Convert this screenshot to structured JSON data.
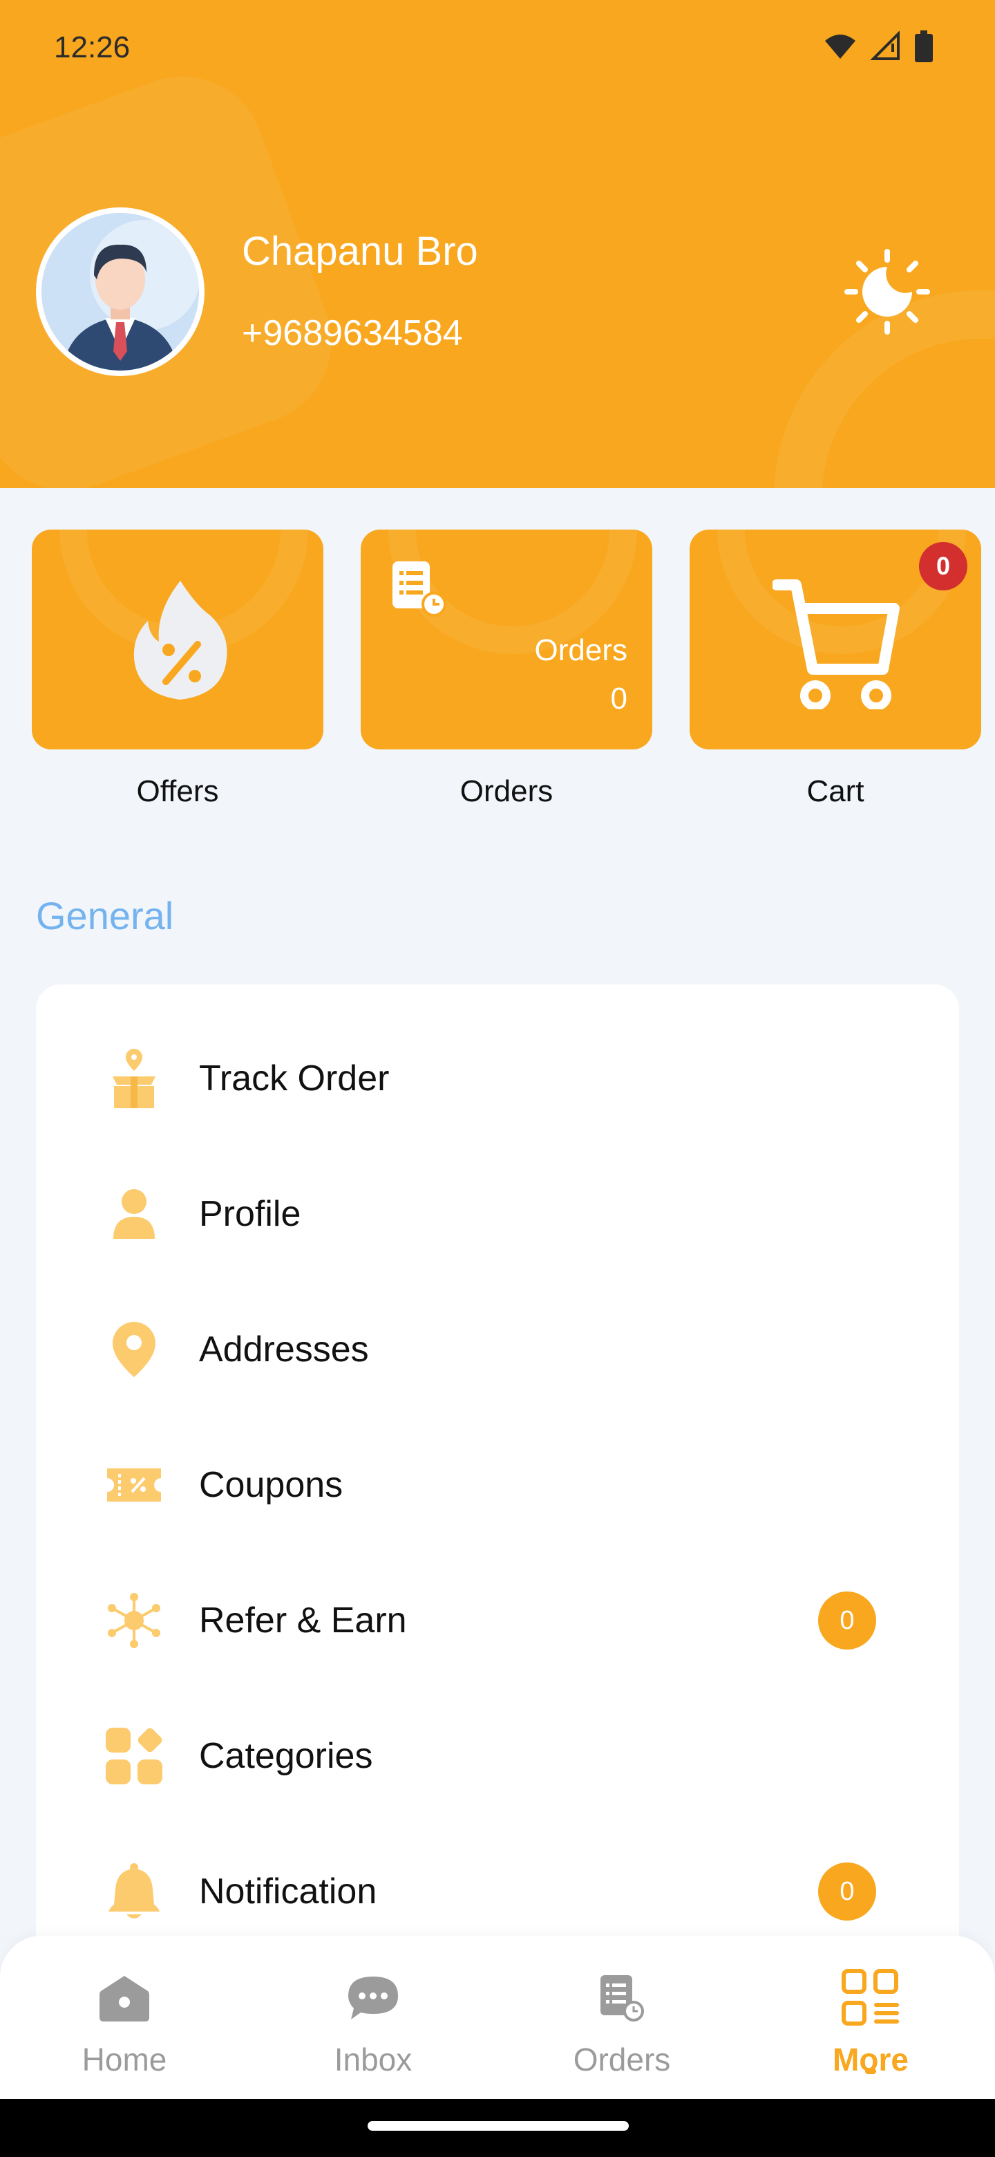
{
  "status_bar": {
    "time": "12:26"
  },
  "profile": {
    "name": "Chapanu Bro",
    "phone": "+9689634584"
  },
  "quick_cards": {
    "offers": {
      "label": "Offers"
    },
    "orders": {
      "label": "Orders",
      "inner_label": "Orders",
      "count": "0"
    },
    "cart": {
      "label": "Cart",
      "badge": "0"
    }
  },
  "general": {
    "title": "General",
    "items": [
      {
        "label": "Track Order",
        "icon": "track-order-icon",
        "badge": ""
      },
      {
        "label": "Profile",
        "icon": "person-icon",
        "badge": ""
      },
      {
        "label": "Addresses",
        "icon": "location-pin-icon",
        "badge": ""
      },
      {
        "label": "Coupons",
        "icon": "coupon-icon",
        "badge": ""
      },
      {
        "label": "Refer & Earn",
        "icon": "network-icon",
        "badge": "0"
      },
      {
        "label": "Categories",
        "icon": "categories-icon",
        "badge": ""
      },
      {
        "label": "Notification",
        "icon": "bell-icon",
        "badge": "0"
      }
    ]
  },
  "bottom_nav": {
    "items": [
      {
        "label": "Home",
        "icon": "home-icon"
      },
      {
        "label": "Inbox",
        "icon": "chat-icon"
      },
      {
        "label": "Orders",
        "icon": "orders-icon"
      },
      {
        "label": "More",
        "icon": "grid-icon",
        "active": true
      }
    ]
  },
  "colors": {
    "accent": "#F8A71E",
    "section_title": "#74B3EE",
    "badge_red": "#D32F2F",
    "icon_light": "#FBCB6E"
  }
}
